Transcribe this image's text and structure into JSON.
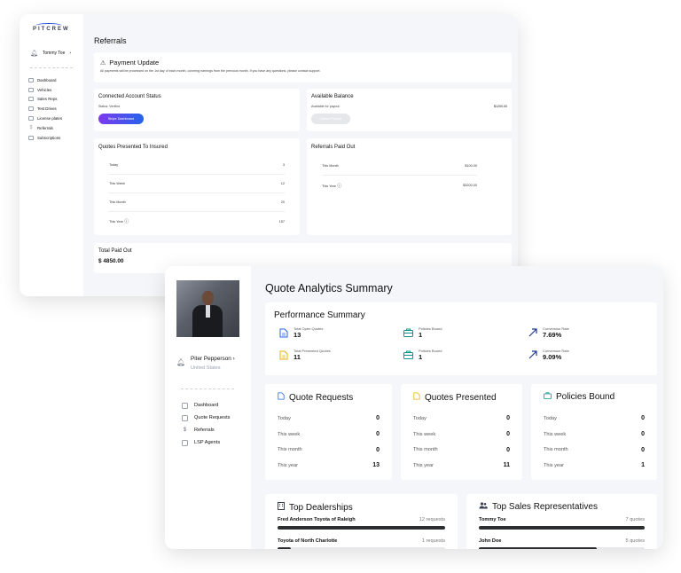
{
  "win1": {
    "logo": "PITCREW",
    "user": "Tommy Toe",
    "nav": [
      "Dashboard",
      "Vehicles",
      "Sales Reps",
      "Test Drives",
      "License plates",
      "Referrals",
      "Subscriptions"
    ],
    "title": "Referrals",
    "payment": {
      "title": "Payment Update",
      "text": "All payments will be processed on the 1st day of each month, covering earnings from the previous month. If you have any questions, please contact support."
    },
    "connected": {
      "title": "Connected Account Status",
      "status": "Status: Verified",
      "button": "Stripe Dashboard"
    },
    "balance": {
      "title": "Available Balance",
      "label": "Available for payout:",
      "value": "$1200.00",
      "button": "Initiate Payout"
    },
    "quotes": {
      "title": "Quotes Presented To Insured",
      "rows": [
        {
          "label": "Today",
          "value": "3"
        },
        {
          "label": "This Week",
          "value": "12"
        },
        {
          "label": "This Month",
          "value": "20"
        },
        {
          "label": "This Year",
          "value": "157"
        }
      ]
    },
    "paidout": {
      "title": "Referrals Paid Out",
      "rows": [
        {
          "label": "This Month",
          "value": "$100.00"
        },
        {
          "label": "This Year",
          "value": "$3200.00"
        }
      ]
    },
    "total": {
      "title": "Total Paid Out",
      "value": "$ 4850.00"
    }
  },
  "win2": {
    "user": {
      "name": "Piter Pepperson",
      "location": "United States"
    },
    "nav": [
      "Dashboard",
      "Quote Requests",
      "Referrals",
      "LSP Agents"
    ],
    "title": "Quote Analytics Summary",
    "performance": {
      "title": "Performance Summary",
      "metrics": [
        {
          "label": "Total Open Quotes",
          "value": "13"
        },
        {
          "label": "Policies Bound",
          "value": "1"
        },
        {
          "label": "Conversion Rate",
          "value": "7.69%"
        },
        {
          "label": "Total Presented Quotes",
          "value": "11"
        },
        {
          "label": "Policies Bound",
          "value": "1"
        },
        {
          "label": "Conversion Rate",
          "value": "9.09%"
        }
      ]
    },
    "stats": [
      {
        "title": "Quote Requests",
        "rows": [
          {
            "label": "Today",
            "value": "0"
          },
          {
            "label": "This week",
            "value": "0"
          },
          {
            "label": "This month",
            "value": "0"
          },
          {
            "label": "This year",
            "value": "13"
          }
        ]
      },
      {
        "title": "Quotes Presented",
        "rows": [
          {
            "label": "Today",
            "value": "0"
          },
          {
            "label": "This week",
            "value": "0"
          },
          {
            "label": "This month",
            "value": "0"
          },
          {
            "label": "This year",
            "value": "11"
          }
        ]
      },
      {
        "title": "Policies Bound",
        "rows": [
          {
            "label": "Today",
            "value": "0"
          },
          {
            "label": "This week",
            "value": "0"
          },
          {
            "label": "This month",
            "value": "0"
          },
          {
            "label": "This year",
            "value": "1"
          }
        ]
      }
    ],
    "dealerships": {
      "title": "Top Dealerships",
      "items": [
        {
          "name": "Fred Anderson Toyota of Raleigh",
          "count": "12 requests",
          "fraction": 1.0
        },
        {
          "name": "Toyota of North Charlotte",
          "count": "1 requests",
          "fraction": 0.08
        }
      ]
    },
    "salesreps": {
      "title": "Top Sales Representatives",
      "items": [
        {
          "name": "Tommy Toe",
          "count": "7 quotes",
          "fraction": 1.0
        },
        {
          "name": "John Doe",
          "count": "5 quotes",
          "fraction": 0.71
        }
      ]
    },
    "colors": {
      "accent": "#7c3aed",
      "blue": "#2563eb",
      "yellow": "#eab308",
      "green": "#0d9488",
      "arrow": "#1e3a8a"
    }
  }
}
